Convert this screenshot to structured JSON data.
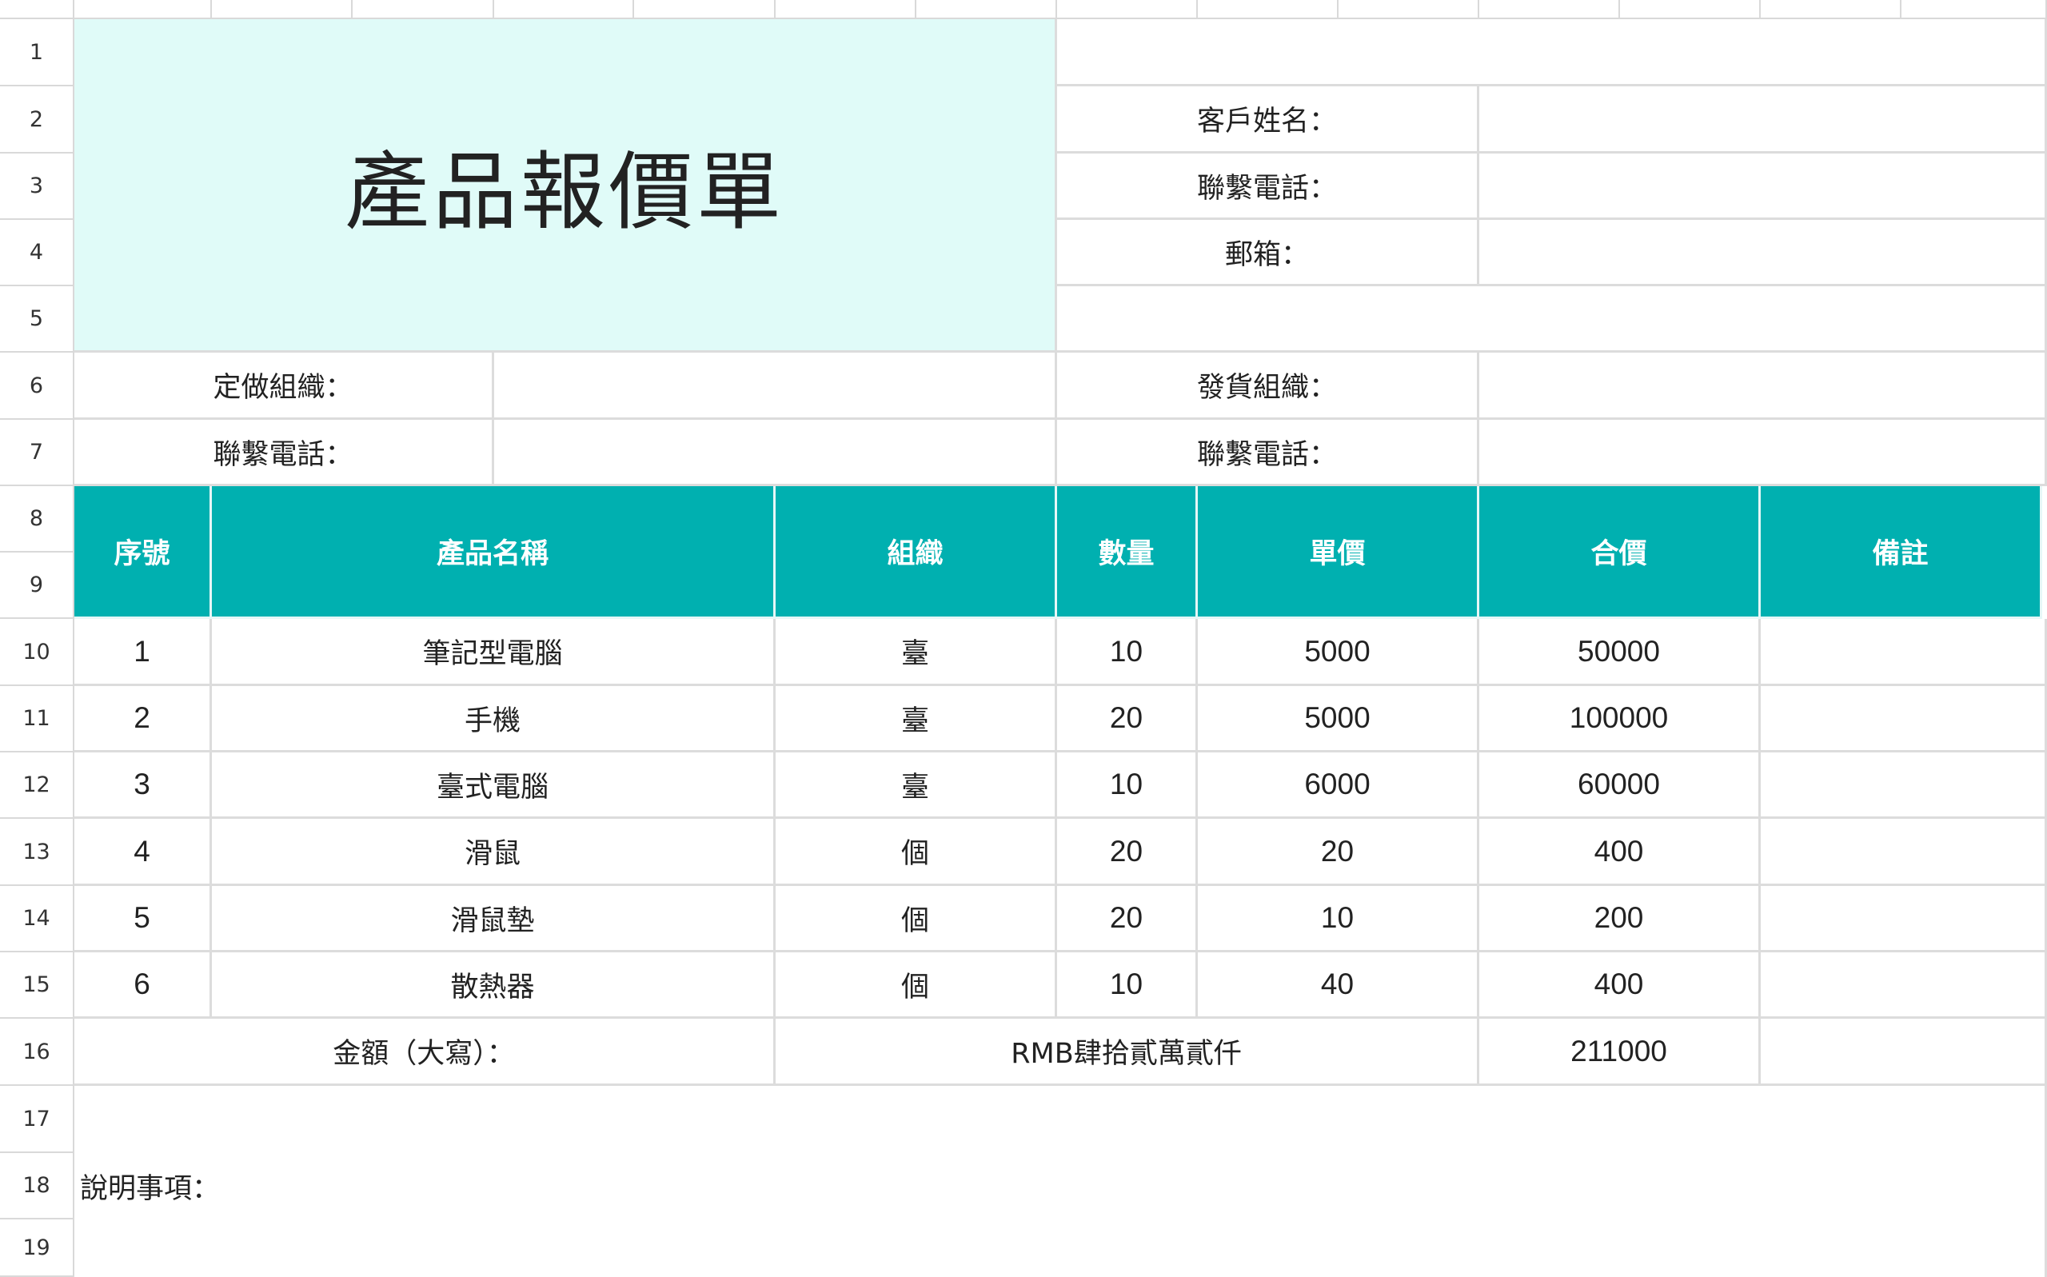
{
  "row_numbers": [
    "1",
    "2",
    "3",
    "4",
    "5",
    "6",
    "7",
    "8",
    "9",
    "10",
    "11",
    "12",
    "13",
    "14",
    "15",
    "16",
    "17",
    "18",
    "19"
  ],
  "title": "產品報價單",
  "customer": {
    "name_label": "客戶姓名：",
    "phone_label": "聯繫電話：",
    "email_label": "郵箱：",
    "name_value": "",
    "phone_value": "",
    "email_value": ""
  },
  "order_org": {
    "label": "定做組織：",
    "phone_label": "聯繫電話：",
    "value": "",
    "phone_value": ""
  },
  "ship_org": {
    "label": "發貨組織：",
    "phone_label": "聯繫電話：",
    "value": "",
    "phone_value": ""
  },
  "table": {
    "headers": [
      "序號",
      "產品名稱",
      "組織",
      "數量",
      "單價",
      "合價",
      "備註"
    ],
    "rows": [
      [
        "1",
        "筆記型電腦",
        "臺",
        "10",
        "5000",
        "50000",
        ""
      ],
      [
        "2",
        "手機",
        "臺",
        "20",
        "5000",
        "100000",
        ""
      ],
      [
        "3",
        "臺式電腦",
        "臺",
        "10",
        "6000",
        "60000",
        ""
      ],
      [
        "4",
        "滑鼠",
        "個",
        "20",
        "20",
        "400",
        ""
      ],
      [
        "5",
        "滑鼠墊",
        "個",
        "20",
        "10",
        "200",
        ""
      ],
      [
        "6",
        "散熱器",
        "個",
        "10",
        "40",
        "400",
        ""
      ]
    ]
  },
  "total": {
    "label": "金額（大寫）：",
    "amount_words": "RMB肆拾貳萬貳仟",
    "amount": "211000"
  },
  "notes_label": "說明事項：",
  "colors": {
    "title_bg": "#e0fbf8",
    "header_bg": "#00b0b0",
    "grid": "#dcdcdc"
  }
}
